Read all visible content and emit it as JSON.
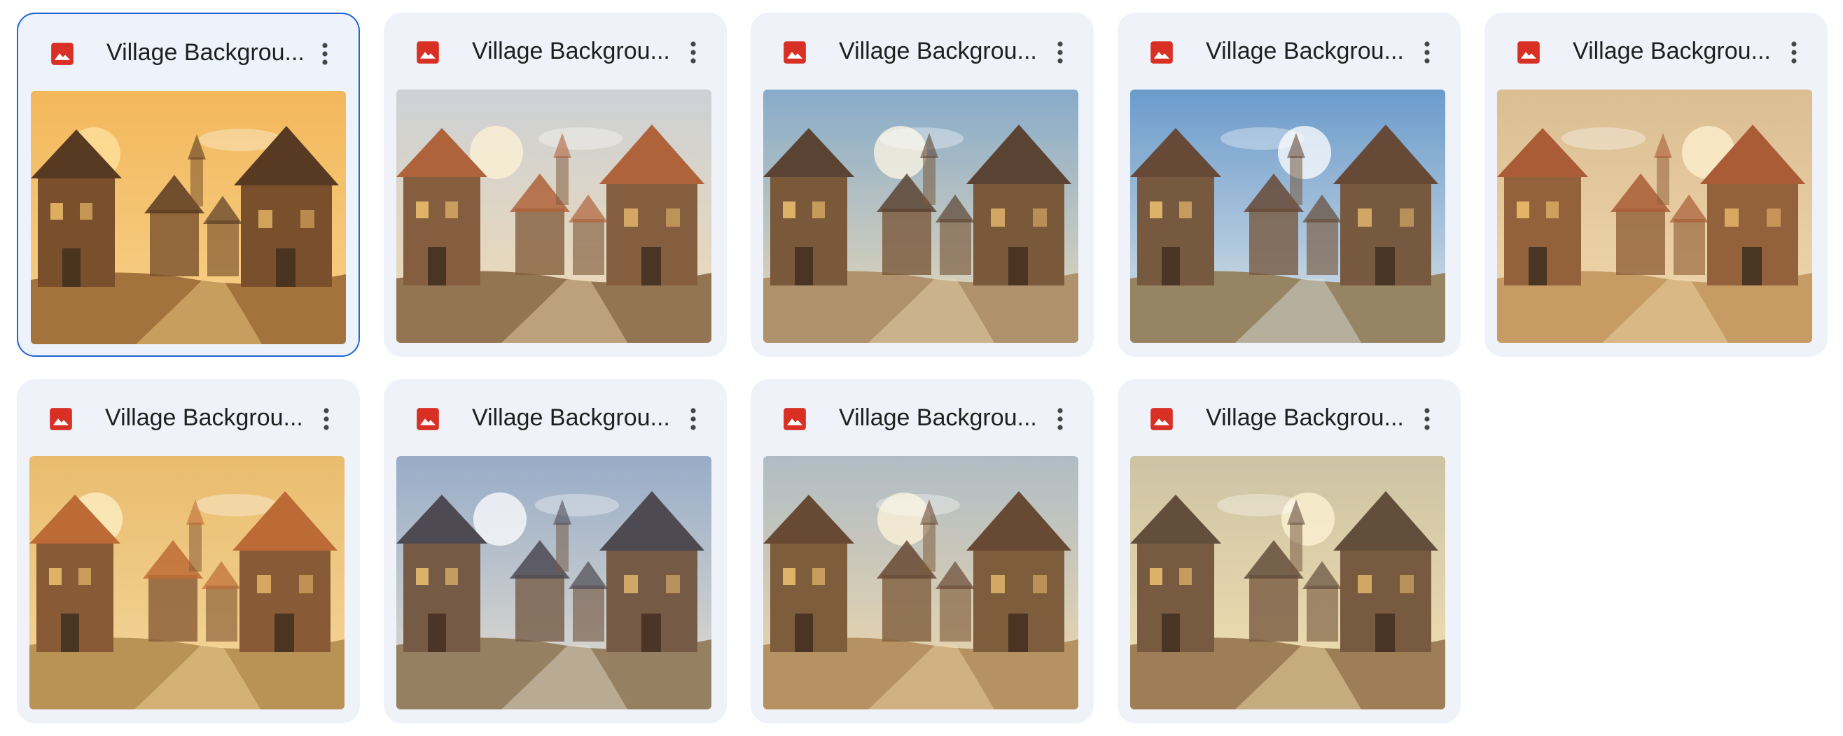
{
  "files": [
    {
      "name": "Village Backgrou...",
      "selected": true,
      "file_icon": "image-file-icon",
      "menu_icon": "more-vert-icon",
      "thumbnail": {
        "sky_top": "#f2b455",
        "sky_bottom": "#f7d08a",
        "ground": "#9b6a34",
        "house": "#6e4322",
        "roof": "#4a2c18",
        "sun": "#ffe3a0"
      }
    },
    {
      "name": "Village Backgrou...",
      "selected": false,
      "file_icon": "image-file-icon",
      "menu_icon": "more-vert-icon",
      "thumbnail": {
        "sky_top": "#c9cfd6",
        "sky_bottom": "#f0d8b0",
        "ground": "#8a6a48",
        "house": "#7a5232",
        "roof": "#a8572e",
        "sun": "#fff3d6"
      }
    },
    {
      "name": "Village Backgrou...",
      "selected": false,
      "file_icon": "image-file-icon",
      "menu_icon": "more-vert-icon",
      "thumbnail": {
        "sky_top": "#7ea6c9",
        "sky_bottom": "#e9d8b4",
        "ground": "#a98a62",
        "house": "#6f4b2c",
        "roof": "#4e3524",
        "sun": "#fff8e4"
      }
    },
    {
      "name": "Village Backgrou...",
      "selected": false,
      "file_icon": "image-file-icon",
      "menu_icon": "more-vert-icon",
      "thumbnail": {
        "sky_top": "#5f93c8",
        "sky_bottom": "#d9e2e6",
        "ground": "#8f7a55",
        "house": "#6c4b2f",
        "roof": "#5a3a26",
        "sun": "#ffffff"
      }
    },
    {
      "name": "Village Backgrou...",
      "selected": false,
      "file_icon": "image-file-icon",
      "menu_icon": "more-vert-icon",
      "thumbnail": {
        "sky_top": "#d8b98e",
        "sky_bottom": "#f2d7ac",
        "ground": "#c2955c",
        "house": "#8a5530",
        "roof": "#a2502a",
        "sun": "#fff1d0"
      }
    },
    {
      "name": "Village Backgrou...",
      "selected": false,
      "file_icon": "image-file-icon",
      "menu_icon": "more-vert-icon",
      "thumbnail": {
        "sky_top": "#e8b865",
        "sky_bottom": "#f4d59a",
        "ground": "#b48a4c",
        "house": "#7e4f2a",
        "roof": "#b8602a",
        "sun": "#fff0c8"
      }
    },
    {
      "name": "Village Backgrou...",
      "selected": false,
      "file_icon": "image-file-icon",
      "menu_icon": "more-vert-icon",
      "thumbnail": {
        "sky_top": "#8fa6c4",
        "sky_bottom": "#e4dccc",
        "ground": "#8d7654",
        "house": "#6a4d36",
        "roof": "#3e3b44",
        "sun": "#ffffff"
      }
    },
    {
      "name": "Village Backgrou...",
      "selected": false,
      "file_icon": "image-file-icon",
      "menu_icon": "more-vert-icon",
      "thumbnail": {
        "sky_top": "#a9b8c4",
        "sky_bottom": "#f0d6a6",
        "ground": "#b08a58",
        "house": "#74512f",
        "roof": "#5b3b26",
        "sun": "#fff4d8"
      }
    },
    {
      "name": "Village Backgrou...",
      "selected": false,
      "file_icon": "image-file-icon",
      "menu_icon": "more-vert-icon",
      "thumbnail": {
        "sky_top": "#c9c0a0",
        "sky_bottom": "#f4dfae",
        "ground": "#96754c",
        "house": "#6d4e34",
        "roof": "#56402f",
        "sun": "#fff6d6"
      }
    }
  ],
  "colors": {
    "card_background": "#eff3f9",
    "selection_border": "#1f66d1",
    "file_icon_red": "#d93025",
    "title_text": "#1f1f1f",
    "menu_icon": "#444746"
  }
}
